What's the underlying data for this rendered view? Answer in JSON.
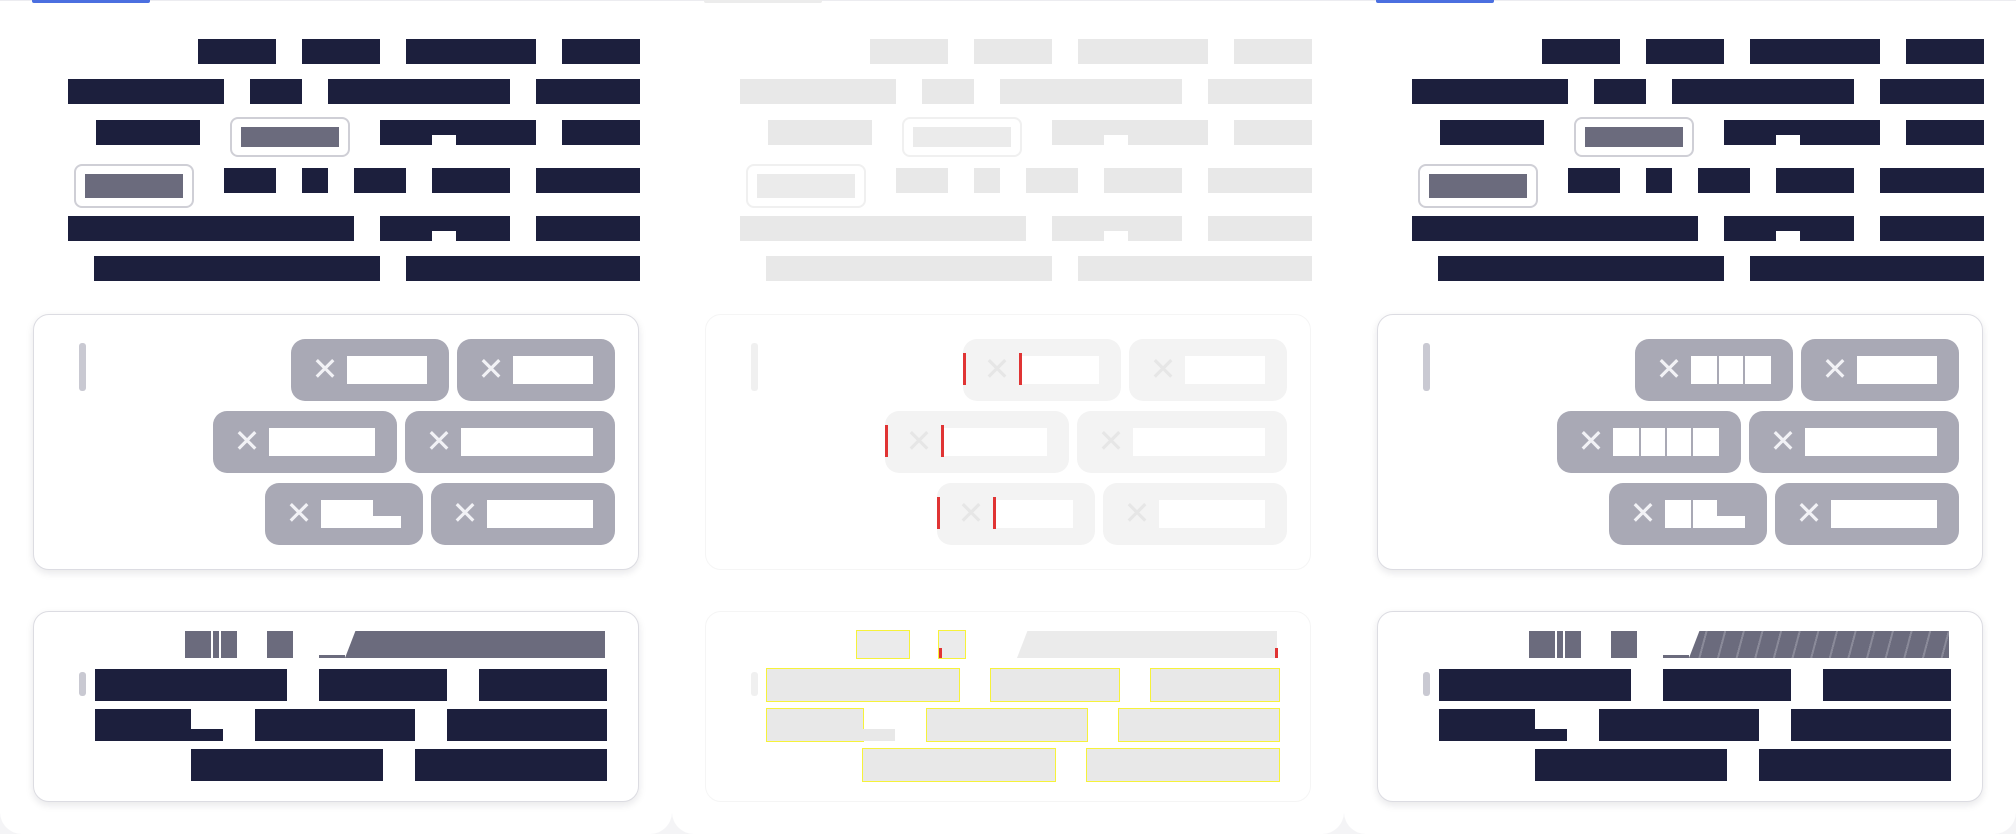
{
  "colors": {
    "ink": "#1c1f3d",
    "muted_ink": "#6b6b7d",
    "chip_bg": "#a9a9b5",
    "accent": "#4b6fe0",
    "faded": "#e8e8e8",
    "highlight": "#f6f23a",
    "warning_mark": "#e03434"
  },
  "panels": [
    {
      "id": "panel-left",
      "state": "active",
      "accent_tab": true
    },
    {
      "id": "panel-middle",
      "state": "faded",
      "accent_tab": false
    },
    {
      "id": "panel-right",
      "state": "active",
      "accent_tab": true
    }
  ],
  "icons": {
    "chip_remove": "close-icon",
    "text_caret": "caret-icon"
  },
  "chip_remove_glyph": "✕",
  "chip_count_per_card": 6
}
